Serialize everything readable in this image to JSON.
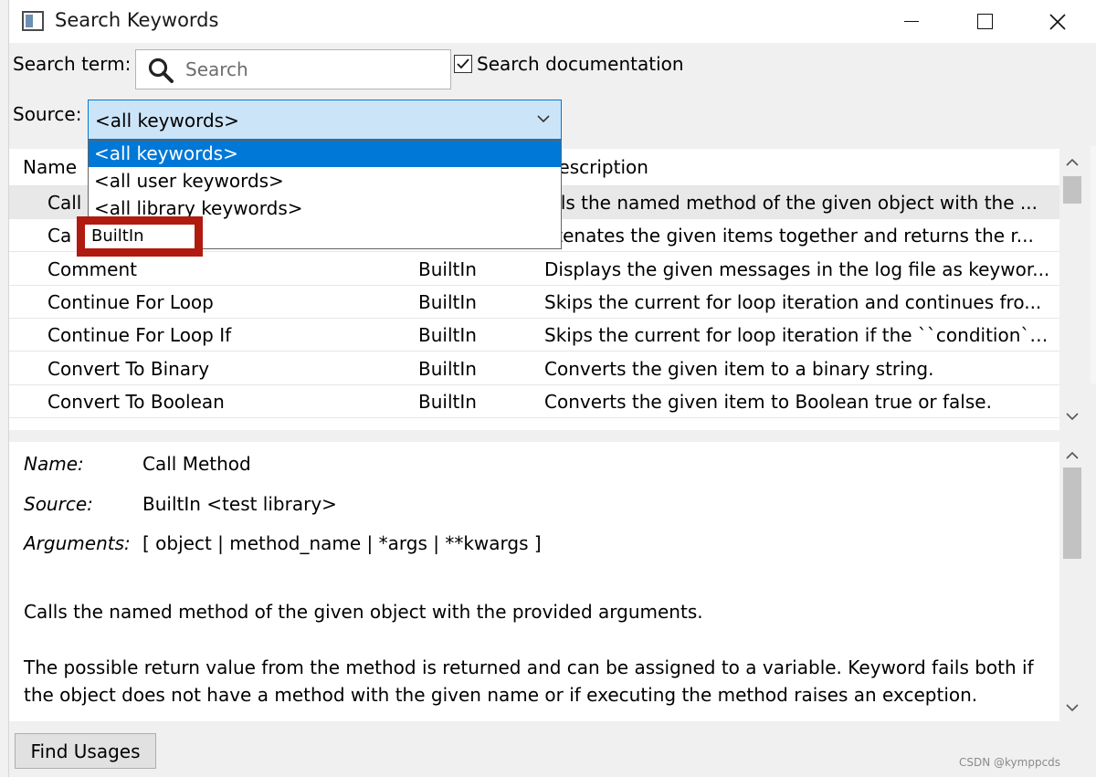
{
  "window": {
    "title": "Search Keywords"
  },
  "search": {
    "label": "Search term:",
    "placeholder": "Search",
    "value": ""
  },
  "documentation": {
    "label": "Search documentation",
    "checked": true
  },
  "source": {
    "label": "Source:",
    "selected": "<all keywords>",
    "options": [
      "<all keywords>",
      "<all user keywords>",
      "<all library keywords>",
      "BuiltIn"
    ]
  },
  "table": {
    "columns": [
      "Name",
      "Description"
    ],
    "rows": [
      {
        "name": "Call",
        "source": "",
        "description": "alls the named method of the given object with the ..."
      },
      {
        "name": "Ca",
        "source": "",
        "description": "atenates the given items together and returns the r..."
      },
      {
        "name": "Comment",
        "source": "BuiltIn",
        "description": "Displays the given messages in the log file as keywor..."
      },
      {
        "name": "Continue For Loop",
        "source": "BuiltIn",
        "description": "Skips the current for loop iteration and continues fro..."
      },
      {
        "name": "Continue For Loop If",
        "source": "BuiltIn",
        "description": "Skips the current for loop iteration if the ``condition``..."
      },
      {
        "name": "Convert To Binary",
        "source": "BuiltIn",
        "description": "Converts the given item to a binary string."
      },
      {
        "name": "Convert To Boolean",
        "source": "BuiltIn",
        "description": "Converts the given item to Boolean true or false."
      }
    ]
  },
  "details": {
    "name_label": "Name:",
    "name_value": "Call Method",
    "source_label": "Source:",
    "source_value": "BuiltIn <test library>",
    "args_label": "Arguments:",
    "args_value": "[ object | method_name | *args | **kwargs ]",
    "paragraph1": "Calls the named method of the given object with the provided arguments.",
    "paragraph2": "The possible return value from the method is returned and can be assigned to a variable. Keyword fails both if the object does not have a method with the given name or if executing the method raises an exception."
  },
  "buttons": {
    "find_usages": "Find Usages"
  },
  "watermark": "CSDN @kymppcds",
  "colors": {
    "accent": "#0078d7",
    "combo_bg": "#cce4f7",
    "annotation": "#b01a0f"
  },
  "icons": [
    "app-icon",
    "search-icon",
    "checkbox-check-icon",
    "chevron-down-icon",
    "scroll-up-icon",
    "scroll-down-icon",
    "minimize-icon",
    "maximize-icon",
    "close-icon"
  ]
}
